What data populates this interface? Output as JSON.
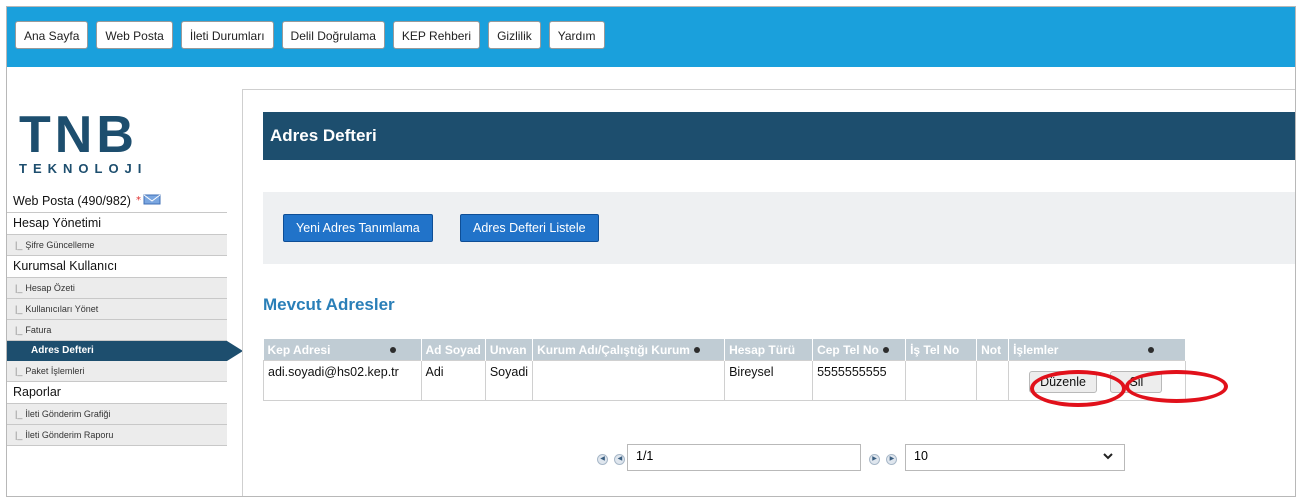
{
  "topnav": [
    "Ana Sayfa",
    "Web Posta",
    "İleti Durumları",
    "Delil Doğrulama",
    "KEP Rehberi",
    "Gizlilik",
    "Yardım"
  ],
  "logo": {
    "main": "TNB",
    "sub": "TEKNOLOJI"
  },
  "sidebar": {
    "webposta": "Web Posta (490/982)",
    "hesap_yonetimi": "Hesap Yönetimi",
    "sifre": "Şifre Güncelleme",
    "kurumsal": "Kurumsal Kullanıcı",
    "hesap_ozeti": "Hesap Özeti",
    "kullanicilari": "Kullanıcıları Yönet",
    "fatura": "Fatura",
    "adres_defteri": "Adres Defteri",
    "paket": "Paket İşlemleri",
    "raporlar": "Raporlar",
    "ileti_grafigi": "İleti Gönderim Grafiği",
    "ileti_raporu": "İleti Gönderim Raporu"
  },
  "main": {
    "title": "Adres Defteri",
    "btn_new": "Yeni Adres Tanımlama",
    "btn_list": "Adres Defteri Listele",
    "section": "Mevcut Adresler"
  },
  "table": {
    "headers": [
      "Kep Adresi",
      "Ad Soyad",
      "Unvan",
      "Kurum Adı/Çalıştığı Kurum",
      "Hesap Türü",
      "Cep Tel No",
      "İş Tel No",
      "Not",
      "İşlemler"
    ],
    "row": {
      "kep": "adi.soyadi@hs02.kep.tr",
      "ad": "Adi",
      "unvan": "Soyadi",
      "kurum": "",
      "hesap": "Bireysel",
      "cep": "5555555555",
      "is": "",
      "not": "",
      "duzenle": "Düzenle",
      "sil": "Sil"
    }
  },
  "pager": {
    "page": "1/1",
    "pagesize": "10"
  },
  "colors": {
    "topbar": "#1aa0dc",
    "navy": "#1d4e6e",
    "button": "#2173c9",
    "highlight": "#e1111b"
  }
}
